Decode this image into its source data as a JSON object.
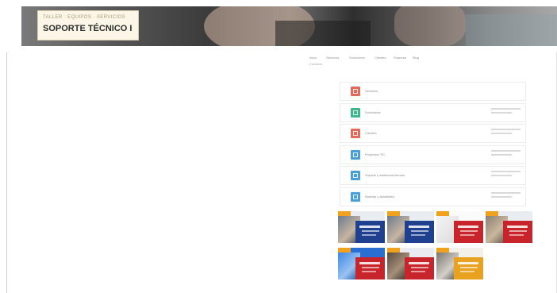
{
  "brand": {
    "subtitle": "TALLER · EQUIPOS · SERVICIOS",
    "title": "SOPORTE TÉCNICO I"
  },
  "nav": {
    "items": [
      "Inicio",
      "Servicios",
      "Soluciones",
      "Clientes",
      "Empresa",
      "Blog"
    ],
    "sub": "Contacto"
  },
  "menu": [
    {
      "label": "Servicios",
      "icon": "tools-icon",
      "color": "#e06a5b",
      "meta": false
    },
    {
      "label": "Soluciones",
      "icon": "cube-icon",
      "color": "#3fb68b",
      "meta": true
    },
    {
      "label": "Clientes",
      "icon": "users-icon",
      "color": "#e06a5b",
      "meta": true
    },
    {
      "label": "Proyectos TIC",
      "icon": "folder-icon",
      "color": "#4a9fd8",
      "meta": true
    },
    {
      "label": "Soporte y asistencia técnica",
      "icon": "headset-icon",
      "color": "#4a9fd8",
      "meta": true
    },
    {
      "label": "Noticias y actualidad",
      "icon": "news-icon",
      "color": "#4a9fd8",
      "meta": true
    }
  ],
  "thumbnails": [
    {
      "name": "promo-1",
      "band_color": "#1f3f8f"
    },
    {
      "name": "promo-2",
      "band_color": "#1f3f8f"
    },
    {
      "name": "promo-3",
      "band_color": "#c8242b"
    },
    {
      "name": "promo-4",
      "band_color": "#c8242b"
    },
    {
      "name": "promo-5",
      "band_color": "#c8242b"
    },
    {
      "name": "promo-6",
      "band_color": "#c8242b"
    },
    {
      "name": "promo-7",
      "band_color": "#e8a21f"
    }
  ]
}
